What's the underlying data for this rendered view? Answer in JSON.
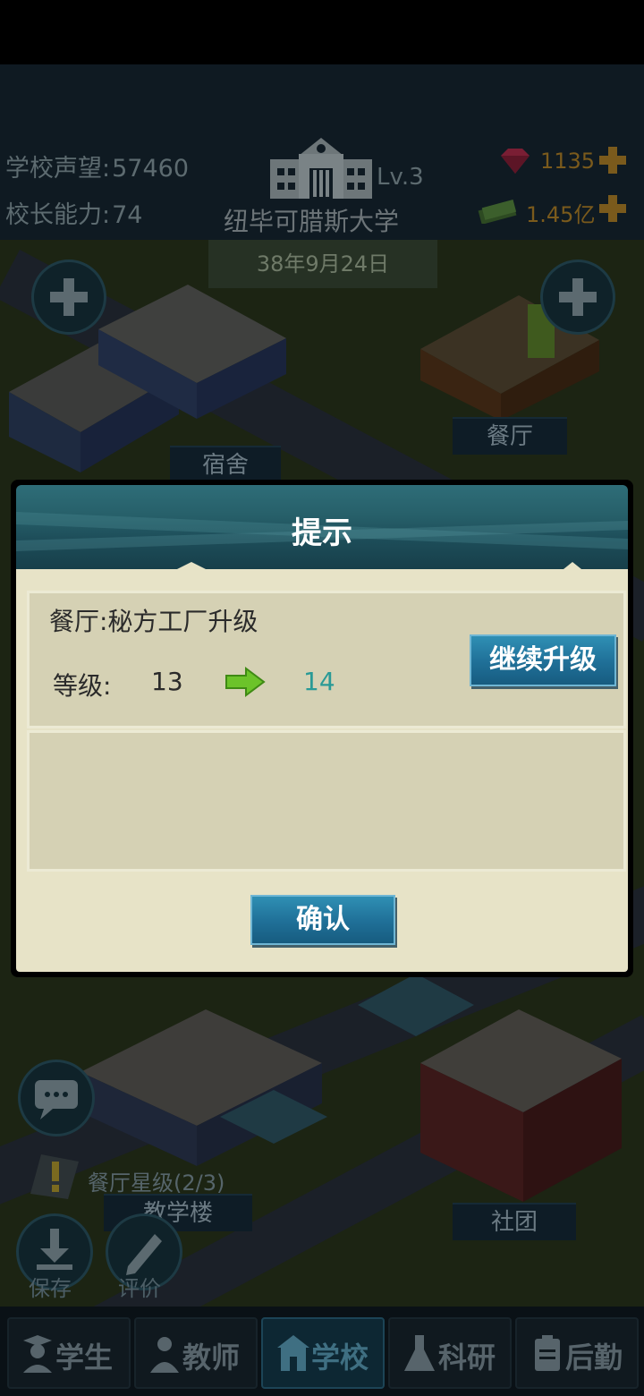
{
  "hud": {
    "reputation_label": "学校声望:",
    "reputation_value": "57460",
    "ability_label": "校长能力:",
    "ability_value": "74",
    "level": "Lv.3",
    "school_name": "纽毕可腊斯大学",
    "gems": "1135",
    "money": "1.45亿",
    "date": "38年9月24日"
  },
  "map": {
    "labels": {
      "dorm": "宿舍",
      "canteen": "餐厅",
      "teaching": "教学楼",
      "club": "社团",
      "canteen_star": "餐厅星级(2/3)"
    },
    "save_label": "保存",
    "review_label": "评价"
  },
  "dialog": {
    "title": "提示",
    "upgrade_title": "餐厅:秘方工厂升级",
    "level_label": "等级:",
    "level_from": "13",
    "level_to": "14",
    "continue_label": "继续升级",
    "confirm_label": "确认"
  },
  "nav": {
    "items": [
      {
        "label": "学生",
        "icon": "student-icon"
      },
      {
        "label": "教师",
        "icon": "teacher-icon"
      },
      {
        "label": "学校",
        "icon": "school-icon"
      },
      {
        "label": "科研",
        "icon": "research-icon"
      },
      {
        "label": "后勤",
        "icon": "logistics-icon"
      }
    ],
    "active": "学校"
  },
  "colors": {
    "dialog_header": "#27606a",
    "dialog_body": "#e7e3c7",
    "button_teal": "#1f6f97",
    "level_up": "#2a9a96",
    "arrow_green": "#6cc32a"
  }
}
